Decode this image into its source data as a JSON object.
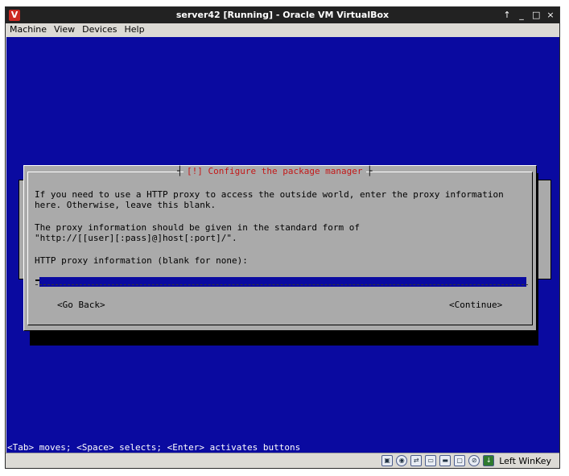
{
  "window": {
    "title": "server42 [Running] - Oracle VM VirtualBox",
    "controls": [
      "↑",
      "_",
      "□",
      "×"
    ]
  },
  "menubar": {
    "items": [
      "Machine",
      "View",
      "Devices",
      "Help"
    ]
  },
  "dialog": {
    "title": "[!] Configure the package manager",
    "line1": "If you need to use a HTTP proxy to access the outside world, enter the proxy information",
    "line2": "here. Otherwise, leave this blank.",
    "line3": "The proxy information should be given in the standard form of",
    "line4": "\"http://[[user][:pass]@]host[:port]/\".",
    "field_label": "HTTP proxy information (blank for none):",
    "field_value": "",
    "back_label": "<Go Back>",
    "continue_label": "<Continue>"
  },
  "status_line": "<Tab> moves; <Space> selects; <Enter> activates buttons",
  "statusbar": {
    "host_key": "Left WinKey",
    "icons": [
      "hdd-icon",
      "cd-icon",
      "network-icon",
      "usb-icon",
      "shared-folder-icon",
      "display-icon",
      "mouse-icon",
      "host-key-icon"
    ]
  }
}
